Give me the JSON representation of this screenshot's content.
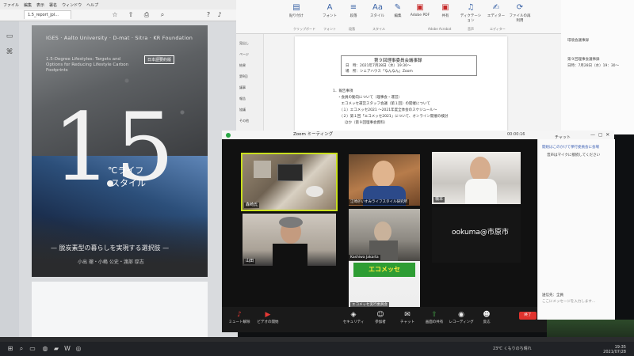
{
  "pdf": {
    "menu": [
      "ファイル",
      "編集",
      "表示",
      "署名",
      "ウィンドウ",
      "ヘルプ"
    ],
    "tab_label": "1.5_report_jpl..."
  },
  "cover": {
    "orgs": "IGES · Aalto University · D-mat · Sitra · KR Foundation",
    "subtitle": "1.5-Degree Lifestyles: Targets and Options for Reducing Lifestyle Carbon Footprints",
    "badge": "日本語要約版",
    "big_one": "1",
    "big_five": "5",
    "style_line_1": "℃ライフ",
    "style_line_2": "スタイル",
    "jp_subtitle": "— 脱炭素型の暮らしを実現する選択肢 —",
    "authors": "小出 瑠・小嶋 公史・渡部 厚志"
  },
  "word": {
    "ribbon": [
      {
        "icon": "clipboard-icon",
        "label": "貼り付け"
      },
      {
        "icon": "font-icon",
        "label": "フォント"
      },
      {
        "icon": "paragraph-icon",
        "label": "段落"
      },
      {
        "icon": "styles-icon",
        "label": "スタイル"
      },
      {
        "icon": "edit-icon",
        "label": "編集"
      },
      {
        "icon": "pdf-icon",
        "label": "Adobe PDF"
      },
      {
        "icon": "share-icon",
        "label": "共有"
      },
      {
        "icon": "dictate-icon",
        "label": "ディクテーション"
      },
      {
        "icon": "editor-icon",
        "label": "エディター"
      },
      {
        "icon": "reuse-icon",
        "label": "ファイルの再利用"
      }
    ],
    "groups": [
      "クリップボード",
      "フォント",
      "段落",
      "スタイル",
      "Adobe Acrobat",
      "音声",
      "エディター"
    ],
    "nav": [
      "見出し",
      "ページ",
      "結果",
      "第9回",
      "議事",
      "報告",
      "協議",
      "その他"
    ],
    "doc_title": "第９回理事委員会議事録",
    "doc_date": "日　時：2021年7月28日（水）19:30～",
    "doc_place": "場　所：シェアハウス「なんなん」Zoom",
    "lines": [
      "1．報告事項",
      "・会員の動向について（理事会・運営）",
      "　エコメッセ運営スタッフ会議（第１回）の開催について",
      "　（１）エコメッセ2021 ～2021年度全体会のスケジュール～",
      "　（２）第１回「エコメッセ2021」について、オンライン開催の検討",
      "　　ほか（第９回理事会資料）"
    ]
  },
  "right_bg": {
    "lines": [
      "環境会議事録",
      "第９回理事会議事録",
      "日時：7月28日（水）19：30～"
    ]
  },
  "zoom": {
    "title": "Zoom ミーティング",
    "clock": "00:00:16",
    "participants": [
      {
        "id": "morisaki",
        "name": "森崎氏"
      },
      {
        "id": "ezaki",
        "name": "江崎＠いすみライフスタイル研究所"
      },
      {
        "id": "hashimoto",
        "name": "橋本"
      },
      {
        "id": "yamada",
        "name": "山田"
      },
      {
        "id": "kashiwa",
        "name": "Kashiwa Jakarta"
      },
      {
        "id": "ookuma",
        "name": "ookuma@市原市"
      },
      {
        "id": "ecomesse",
        "name": "エコメッセ実行委員会"
      }
    ],
    "eco_banner": "エコメッセ",
    "toolbar": [
      {
        "icon": "mic-icon",
        "label": "ミュート解除"
      },
      {
        "icon": "video-icon",
        "label": "ビデオの開始"
      },
      {
        "icon": "security-icon",
        "label": "セキュリティ"
      },
      {
        "icon": "participants-icon",
        "label": "参加者"
      },
      {
        "icon": "chat-icon",
        "label": "チャット"
      },
      {
        "icon": "share-screen-icon",
        "label": "画面の共有"
      },
      {
        "icon": "record-icon",
        "label": "レコーディング"
      },
      {
        "icon": "reactions-icon",
        "label": "反応"
      }
    ],
    "end_label": "終了",
    "chat": {
      "title": "チャット",
      "message_1": "開始はこのかけて挙行委員会に会場",
      "message_2": "音声はマイクに接続してください",
      "to_label": "送信先：全員",
      "input_placeholder": "ここにメッセージを入力します..."
    }
  },
  "taskbar": {
    "weather": "23℃ くもりのち晴れ",
    "time": "19:35",
    "date": "2021/07/28"
  }
}
